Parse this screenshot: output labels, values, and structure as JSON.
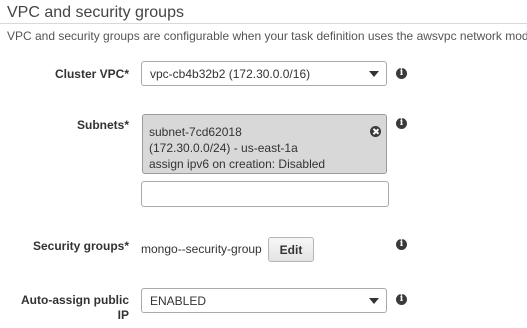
{
  "section": {
    "title": "VPC and security groups",
    "description": "VPC and security groups are configurable when your task definition uses the awsvpc network mode."
  },
  "cluster_vpc": {
    "label": "Cluster VPC*",
    "selected": "vpc-cb4b32b2 (172.30.0.0/16)",
    "info_glyph": "i"
  },
  "subnets": {
    "label": "Subnets*",
    "info_glyph": "i",
    "selected": [
      {
        "line1": "subnet-7cd62018",
        "line2": "(172.30.0.0/24) - us-east-1a",
        "line3": "assign ipv6 on creation: Disabled"
      }
    ],
    "add_value": ""
  },
  "security_groups": {
    "label": "Security groups*",
    "value": "mongo--security-group",
    "edit_label": "Edit",
    "info_glyph": "i"
  },
  "auto_assign_public_ip": {
    "label_line1": "Auto-assign public",
    "label_line2": "IP",
    "selected": "ENABLED",
    "info_glyph": "i"
  },
  "icons": {
    "info": "info-icon",
    "remove": "close-circle-icon",
    "dropdown": "caret-down-icon"
  },
  "colors": {
    "chip_background": "#d8d8d8",
    "icon_dark": "#3a3a3a"
  }
}
